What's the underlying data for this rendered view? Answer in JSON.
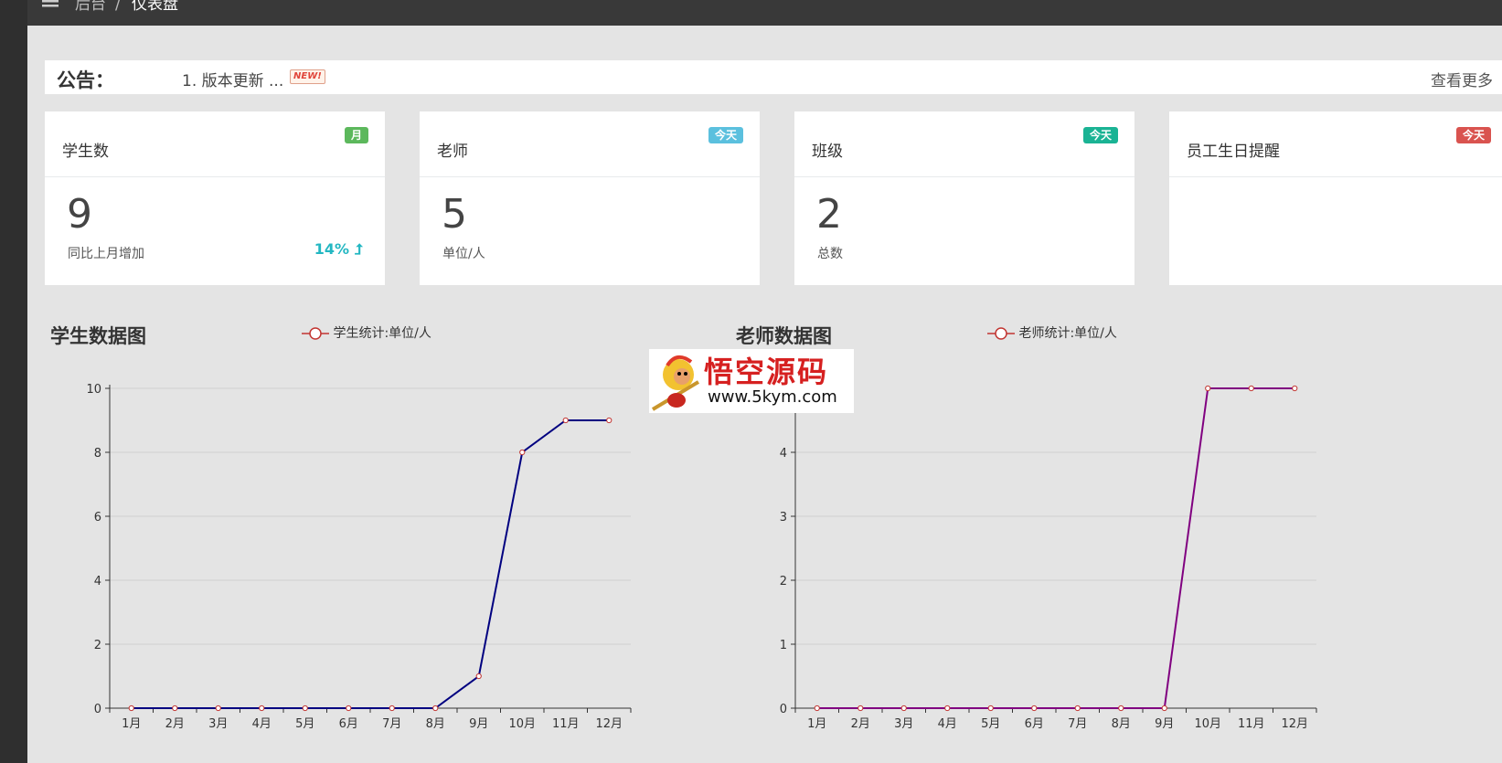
{
  "breadcrumb": {
    "parent": "后台",
    "separator": "/",
    "current": "仪表盘"
  },
  "notice": {
    "label": "公告：",
    "item": "1. 版本更新 ...",
    "new_badge": "NEW!",
    "more": "查看更多"
  },
  "cards": [
    {
      "title": "学生数",
      "badge": "月",
      "badge_color": "#5cb85c",
      "value": "9",
      "subtitle": "同比上月增加",
      "percent": "14% ⮥"
    },
    {
      "title": "老师",
      "badge": "今天",
      "badge_color": "#5bc0de",
      "value": "5",
      "subtitle": "单位/人"
    },
    {
      "title": "班级",
      "badge": "今天",
      "badge_color": "#1ab394",
      "value": "2",
      "subtitle": "总数"
    },
    {
      "title": "员工生日提醒",
      "badge": "今天",
      "badge_color": "#d9534f"
    }
  ],
  "charts": {
    "student": {
      "title": "学生数据图"
    },
    "teacher": {
      "title": "老师数据图"
    }
  },
  "watermark": {
    "title": "悟空源码",
    "url": "www.5kym.com"
  },
  "chart_data": [
    {
      "type": "line",
      "title": "学生数据图",
      "categories": [
        "1月",
        "2月",
        "3月",
        "4月",
        "5月",
        "6月",
        "7月",
        "8月",
        "9月",
        "10月",
        "11月",
        "12月"
      ],
      "series": [
        {
          "name": "学生统计:单位/人",
          "values": [
            0,
            0,
            0,
            0,
            0,
            0,
            0,
            0,
            1,
            8,
            9,
            9
          ],
          "color": "#000080"
        }
      ],
      "yticks": [
        0,
        2,
        4,
        6,
        8,
        10
      ],
      "ylim": [
        0,
        10
      ],
      "grid": true,
      "legend": "top"
    },
    {
      "type": "line",
      "title": "老师数据图",
      "categories": [
        "1月",
        "2月",
        "3月",
        "4月",
        "5月",
        "6月",
        "7月",
        "8月",
        "9月",
        "10月",
        "11月",
        "12月"
      ],
      "series": [
        {
          "name": "老师统计:单位/人",
          "values": [
            0,
            0,
            0,
            0,
            0,
            0,
            0,
            0,
            0,
            5,
            5,
            5
          ],
          "color": "#800080"
        }
      ],
      "yticks": [
        0,
        1,
        2,
        3,
        4
      ],
      "ylim": [
        0,
        5
      ],
      "grid": true,
      "legend": "top"
    }
  ]
}
